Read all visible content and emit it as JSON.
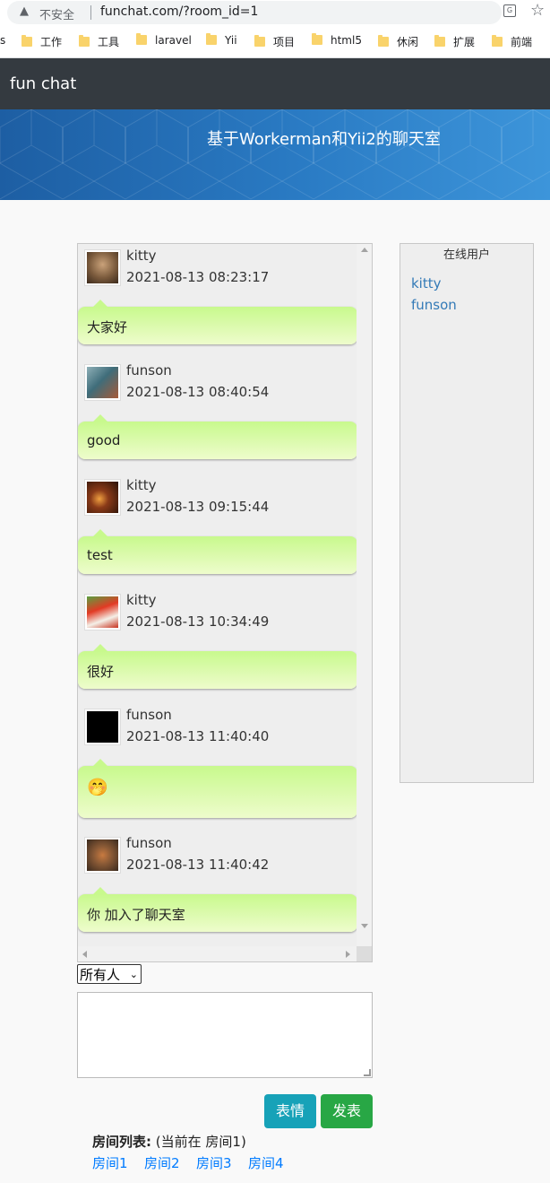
{
  "browser": {
    "security_label": "不安全",
    "url": "funchat.com/?room_id=1",
    "bookmarks": [
      {
        "label": "s"
      },
      {
        "label": "工作"
      },
      {
        "label": "工具"
      },
      {
        "label": "laravel"
      },
      {
        "label": "Yii"
      },
      {
        "label": "项目"
      },
      {
        "label": "html5"
      },
      {
        "label": "休闲"
      },
      {
        "label": "扩展"
      },
      {
        "label": "前端"
      }
    ]
  },
  "navbar": {
    "brand": "fun chat"
  },
  "banner": {
    "title": "基于Workerman和Yii2的聊天室"
  },
  "messages": [
    {
      "user": "kitty",
      "time": "2021-08-13 08:23:17",
      "text": "大家好",
      "avatar_color": "#7a5a3c"
    },
    {
      "user": "funson",
      "time": "2021-08-13 08:40:54",
      "text": "good",
      "avatar_color": "#3f6d7a"
    },
    {
      "user": "kitty",
      "time": "2021-08-13 09:15:44",
      "text": "test",
      "avatar_color": "#5a2a14"
    },
    {
      "user": "kitty",
      "time": "2021-08-13 10:34:49",
      "text": "很好",
      "avatar_color": "#c8321e"
    },
    {
      "user": "funson",
      "time": "2021-08-13 11:40:40",
      "text": "🤭",
      "avatar_color": "#000000"
    },
    {
      "user": "funson",
      "time": "2021-08-13 11:40:42",
      "text": "你 加入了聊天室",
      "avatar_color": "#8a5a36"
    }
  ],
  "online": {
    "title": "在线用户",
    "users": [
      "kitty",
      "funson"
    ]
  },
  "compose": {
    "target_selected": "所有人",
    "message_value": "",
    "emoji_button": "表情",
    "send_button": "发表"
  },
  "rooms": {
    "label": "房间列表:",
    "current": "(当前在 房间1)",
    "items": [
      "房间1",
      "房间2",
      "房间3",
      "房间4"
    ]
  },
  "colors": {
    "navbar": "#343a40",
    "banner": "#2a7bc4",
    "bubble": "#c8f98d",
    "info_button": "#17a2b8",
    "success_button": "#28a745",
    "link": "#007bff"
  }
}
